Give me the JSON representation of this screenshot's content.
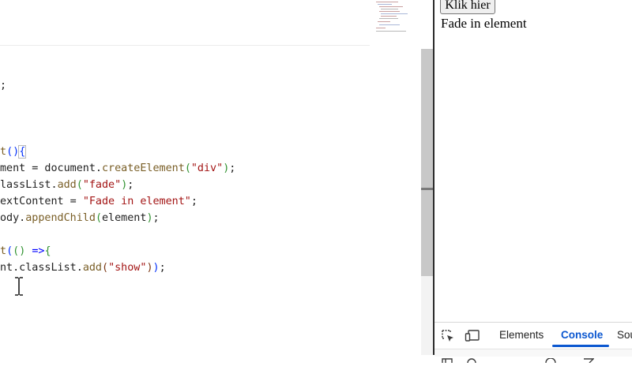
{
  "editor": {
    "lines": [
      {
        "parts": [
          {
            "t": ";"
          }
        ]
      },
      {
        "parts": [
          {
            "t": "t",
            "c": "tk-fn"
          },
          {
            "t": "(",
            "c": "tk-br1"
          },
          {
            "t": ")",
            "c": "tk-br1"
          },
          {
            "t": "{",
            "c": "tk-br1 box"
          }
        ]
      },
      {
        "parts": [
          {
            "t": "ment = document."
          },
          {
            "t": "createElement",
            "c": "tk-fn"
          },
          {
            "t": "(",
            "c": "tk-br2"
          },
          {
            "t": "\"div\"",
            "c": "tk-str"
          },
          {
            "t": ")",
            "c": "tk-br2"
          },
          {
            "t": ";"
          }
        ]
      },
      {
        "parts": [
          {
            "t": "lassList."
          },
          {
            "t": "add",
            "c": "tk-fn"
          },
          {
            "t": "(",
            "c": "tk-br2"
          },
          {
            "t": "\"fade\"",
            "c": "tk-str"
          },
          {
            "t": ")",
            "c": "tk-br2"
          },
          {
            "t": ";"
          }
        ]
      },
      {
        "parts": [
          {
            "t": "extContent = "
          },
          {
            "t": "\"Fade in element\"",
            "c": "tk-str"
          },
          {
            "t": ";"
          }
        ]
      },
      {
        "parts": [
          {
            "t": "ody."
          },
          {
            "t": "appendChild",
            "c": "tk-fn"
          },
          {
            "t": "(",
            "c": "tk-br2"
          },
          {
            "t": "element"
          },
          {
            "t": ")",
            "c": "tk-br2"
          },
          {
            "t": ";"
          }
        ]
      },
      {
        "parts": [
          {
            "t": "t",
            "c": "tk-fn"
          },
          {
            "t": "(",
            "c": "tk-br1"
          },
          {
            "t": "(",
            "c": "tk-br2"
          },
          {
            "t": ")",
            "c": "tk-br2"
          },
          {
            "t": " "
          },
          {
            "t": "=>",
            "c": "tk-kw"
          },
          {
            "t": "{",
            "c": "tk-br2"
          }
        ]
      },
      {
        "parts": [
          {
            "t": "nt.classList."
          },
          {
            "t": "add",
            "c": "tk-fn"
          },
          {
            "t": "(",
            "c": "tk-br3"
          },
          {
            "t": "\"show\"",
            "c": "tk-str"
          },
          {
            "t": ")",
            "c": "tk-br3"
          },
          {
            "t": ")",
            "c": "tk-br1"
          },
          {
            "t": ";"
          }
        ]
      }
    ]
  },
  "preview": {
    "button_label": "Klik hier",
    "fade_text": "Fade in element"
  },
  "devtools": {
    "tabs": [
      {
        "label": "Elements",
        "active": false
      },
      {
        "label": "Console",
        "active": true
      },
      {
        "label": "Sou",
        "active": false
      }
    ],
    "accent": "#0b57d0"
  },
  "icons": [
    "inspect-element-icon",
    "device-toolbar-icon",
    "text-cursor-icon"
  ]
}
